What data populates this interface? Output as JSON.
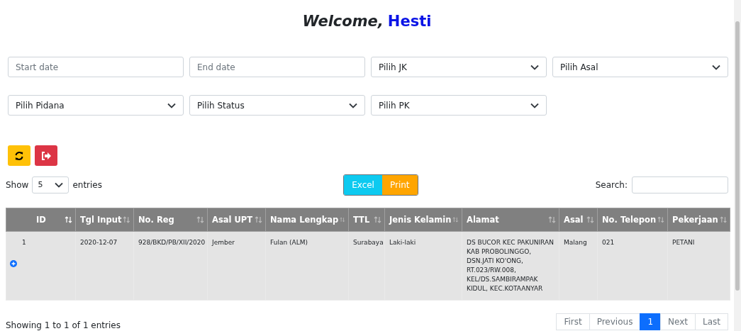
{
  "greeting": {
    "text": "Welcome,",
    "name": "Hesti"
  },
  "filters": [
    {
      "kind": "input",
      "placeholder": "Start date"
    },
    {
      "kind": "input",
      "placeholder": "End date"
    },
    {
      "kind": "select",
      "value": "Pilih JK"
    },
    {
      "kind": "select",
      "value": "Pilih Asal"
    },
    {
      "kind": "select",
      "value": "Pilih Pidana"
    },
    {
      "kind": "select",
      "value": "Pilih Status"
    },
    {
      "kind": "select",
      "value": "Pilih PK"
    }
  ],
  "actions": [
    {
      "kind": "refresh"
    },
    {
      "kind": "logout"
    }
  ],
  "length": {
    "before": "Show",
    "value": "5",
    "after": "entries"
  },
  "export_buttons": [
    {
      "kind": "excel",
      "label": "Excel"
    },
    {
      "kind": "print",
      "label": "Print"
    }
  ],
  "search": {
    "label": "Search:"
  },
  "table": {
    "columns": [
      {
        "label": "ID",
        "sorted": true
      },
      {
        "label": "Tgl Input",
        "sorted": false
      },
      {
        "label": "No. Reg",
        "sorted": false
      },
      {
        "label": "Asal UPT",
        "sorted": false
      },
      {
        "label": "Nama Lengkap",
        "sorted": false
      },
      {
        "label": "TTL",
        "sorted": false
      },
      {
        "label": "Jenis Kelamin",
        "sorted": false
      },
      {
        "label": "Alamat",
        "sorted": false
      },
      {
        "label": "Asal",
        "sorted": false
      },
      {
        "label": "No. Telepon",
        "sorted": false
      },
      {
        "label": "Pekerjaan",
        "sorted": false
      }
    ],
    "rows": [
      {
        "expandable": true,
        "cells": [
          "1",
          "2020-12-07",
          "928/BKD/PB/XII/2020",
          "Jember",
          "Fulan (ALM)",
          "Surabaya",
          "Laki-laki",
          "DS BUCOR KEC PAKUNIRAN KAB PROBOLINGGO, DSN.JATI KO'ONG, RT.023/RW.008, KEL/DS.SAMBIRAMPAK KIDUL, KEC.KOTAANYAR",
          "Malang",
          "021",
          "PETANI"
        ]
      }
    ]
  },
  "info": "Showing 1 to 1 of 1 entries",
  "pagination": [
    {
      "label": "First",
      "selected": false
    },
    {
      "label": "Previous",
      "selected": false
    },
    {
      "label": "1",
      "selected": true
    },
    {
      "label": "Next",
      "selected": false
    },
    {
      "label": "Last",
      "selected": false
    }
  ]
}
